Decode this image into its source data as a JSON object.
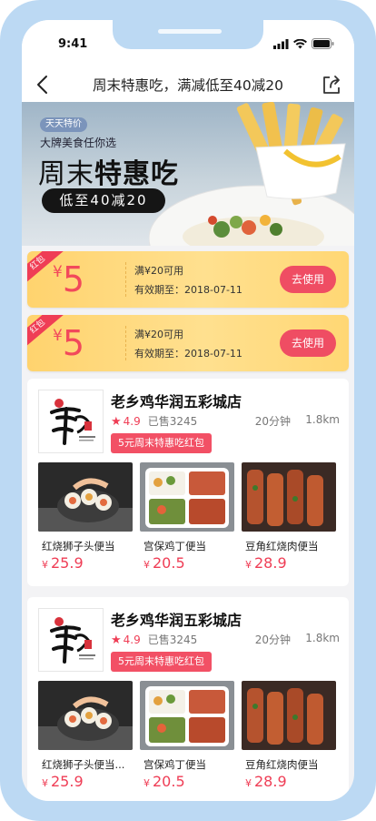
{
  "status_bar": {
    "time": "9:41"
  },
  "nav": {
    "title": "周末特惠吃，满减低至40减20"
  },
  "banner": {
    "tag": "天天特价",
    "subtitle": "大牌美食任你选",
    "title_prefix": "周末",
    "title_bold": "特惠吃",
    "pill": "低至40减20"
  },
  "coupons": [
    {
      "ribbon": "红包",
      "currency": "¥",
      "amount": "5",
      "condition": "满¥20可用",
      "expiry": "有效期至：2018-07-11",
      "button": "去使用"
    },
    {
      "ribbon": "红包",
      "currency": "¥",
      "amount": "5",
      "condition": "满¥20可用",
      "expiry": "有效期至：2018-07-11",
      "button": "去使用"
    }
  ],
  "stores": [
    {
      "name": "老乡鸡华润五彩城店",
      "rating": "4.9",
      "sold": "已售3245",
      "time": "20分钟",
      "distance": "1.8km",
      "promo": "5元周末特惠吃红包",
      "dishes": [
        {
          "name": "红烧狮子头便当",
          "currency": "¥",
          "price": "25.9",
          "image": "sushi-roll"
        },
        {
          "name": "宫保鸡丁便当",
          "currency": "¥",
          "price": "20.5",
          "image": "bento-box"
        },
        {
          "name": "豆角红烧肉便当",
          "currency": "¥",
          "price": "28.9",
          "image": "grilled-skewers"
        }
      ]
    },
    {
      "name": "老乡鸡华润五彩城店",
      "rating": "4.9",
      "sold": "已售3245",
      "time": "20分钟",
      "distance": "1.8km",
      "promo": "5元周末特惠吃红包",
      "dishes": [
        {
          "name": "红烧狮子头便当...",
          "currency": "¥",
          "price": "25.9",
          "image": "sushi-roll"
        },
        {
          "name": "宫保鸡丁便当",
          "currency": "¥",
          "price": "20.5",
          "image": "bento-box"
        },
        {
          "name": "豆角红烧肉便当",
          "currency": "¥",
          "price": "28.9",
          "image": "grilled-skewers"
        }
      ]
    }
  ],
  "colors": {
    "accent": "#ef3d55",
    "coupon_bg": "#ffd774",
    "frame": "#bcd9f3"
  },
  "icons": [
    "back-arrow-icon",
    "share-icon",
    "star-icon",
    "signal-icon",
    "wifi-icon",
    "battery-icon"
  ]
}
